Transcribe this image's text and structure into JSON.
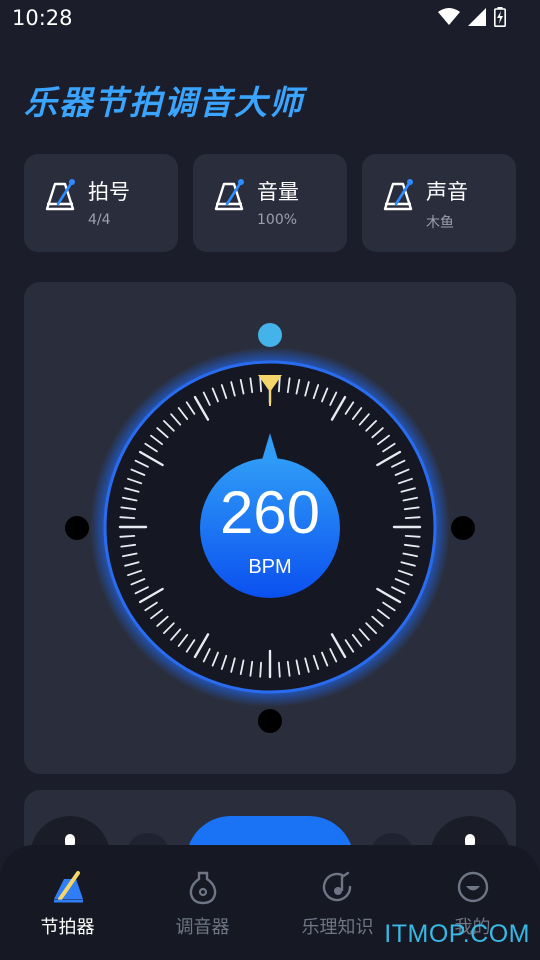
{
  "status_bar": {
    "time": "10:28"
  },
  "app": {
    "title": "乐器节拍调音大师"
  },
  "settings": [
    {
      "label": "拍号",
      "value": "4/4",
      "icon": "metronome-icon"
    },
    {
      "label": "音量",
      "value": "100%",
      "icon": "metronome-icon"
    },
    {
      "label": "声音",
      "value": "木鱼",
      "icon": "metronome-icon"
    }
  ],
  "metronome": {
    "bpm": "260",
    "unit": "BPM"
  },
  "nav": [
    {
      "label": "节拍器",
      "icon": "metronome-nav-icon",
      "active": true
    },
    {
      "label": "调音器",
      "icon": "guitar-icon",
      "active": false
    },
    {
      "label": "乐理知识",
      "icon": "music-note-icon",
      "active": false
    },
    {
      "label": "我的",
      "icon": "profile-icon",
      "active": false
    }
  ],
  "watermark": "ITMOP.COM",
  "colors": {
    "accent": "#1a72f5",
    "title": "#3aa4ff",
    "card": "#2a2e3c",
    "indicator": "#f5d66a"
  }
}
